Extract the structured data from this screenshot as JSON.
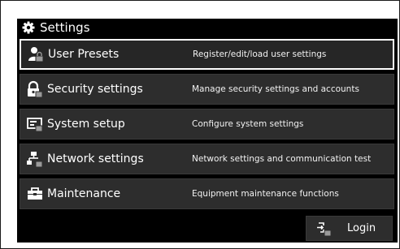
{
  "title": "Settings",
  "rows": [
    {
      "label": "User Presets",
      "desc": "Register/edit/load user settings",
      "icon": "user-lock-icon"
    },
    {
      "label": "Security settings",
      "desc": "Manage security settings and accounts",
      "icon": "padlock-icon"
    },
    {
      "label": "System setup",
      "desc": "Configure system settings",
      "icon": "system-screen-icon"
    },
    {
      "label": "Network settings",
      "desc": "Network settings and communication test",
      "icon": "network-icon"
    },
    {
      "label": "Maintenance",
      "desc": "Equipment maintenance functions",
      "icon": "toolbox-icon"
    }
  ],
  "login_label": "Login",
  "selected_row": 0,
  "colors": {
    "background": "#000000",
    "row": "#2d2d2d",
    "text": "#ffffff",
    "selected_border": "#ffffff"
  }
}
